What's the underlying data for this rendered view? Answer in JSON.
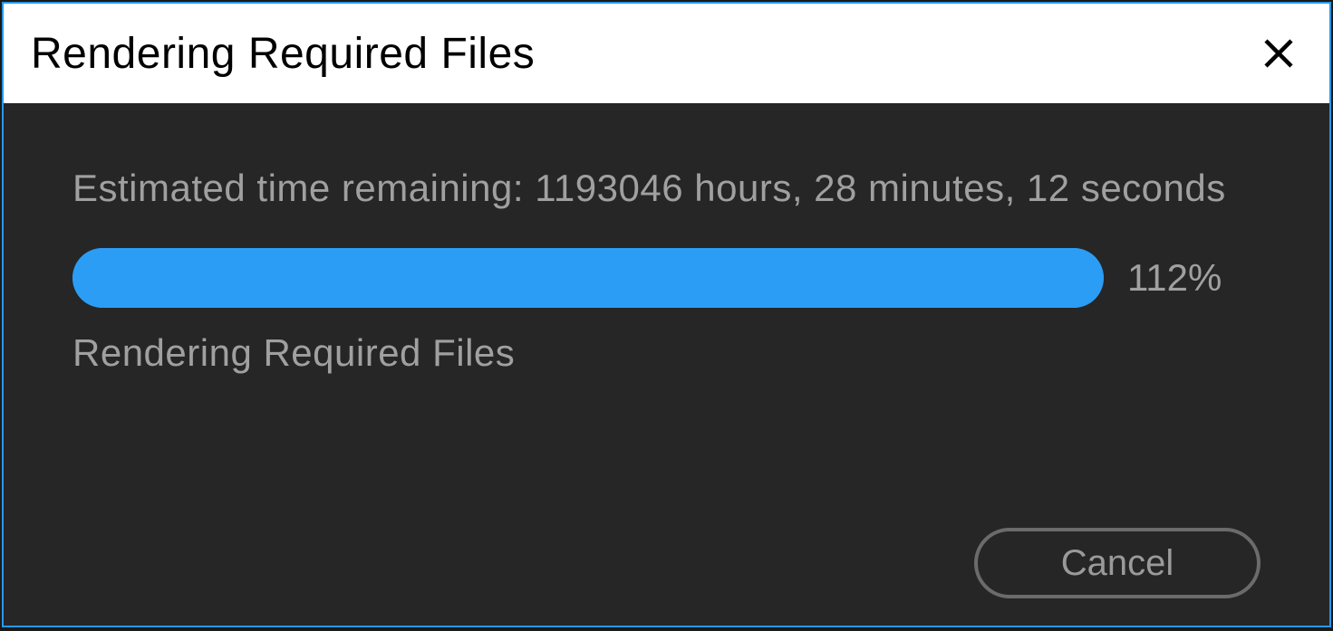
{
  "dialog": {
    "title": "Rendering Required Files",
    "estimated_time": "Estimated time remaining: 1193046 hours, 28 minutes, 12 seconds",
    "progress_percent": "112%",
    "status": "Rendering Required Files",
    "cancel_label": "Cancel"
  }
}
